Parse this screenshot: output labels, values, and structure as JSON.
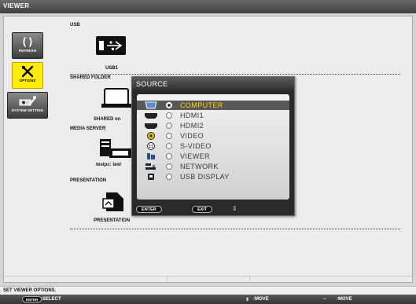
{
  "app": {
    "title": "VIEWER"
  },
  "sidebar": {
    "refresh_label": "REFRESH",
    "options_label": "OPTIONS",
    "system_setting_label": "SYSTEM SETTING"
  },
  "sections": {
    "usb": {
      "title": "USB",
      "item_label": "USB1"
    },
    "shared_folder": {
      "title": "SHARED FOLDER",
      "item_label": "SHARED on"
    },
    "media_server": {
      "title": "MEDIA SERVER",
      "item_label": "testpc: test"
    },
    "presentation": {
      "title": "PRESENTATION",
      "item_label": "PRESENTATION"
    }
  },
  "source_dialog": {
    "title": "SOURCE",
    "selected": "COMPUTER",
    "sources": [
      {
        "name": "COMPUTER",
        "icon": "computer-port-icon"
      },
      {
        "name": "HDMI1",
        "icon": "hdmi-icon"
      },
      {
        "name": "HDMI2",
        "icon": "hdmi-icon"
      },
      {
        "name": "VIDEO",
        "icon": "video-rca-icon"
      },
      {
        "name": "S-VIDEO",
        "icon": "s-video-icon"
      },
      {
        "name": "VIEWER",
        "icon": "viewer-icon"
      },
      {
        "name": "NETWORK",
        "icon": "network-icon"
      },
      {
        "name": "USB DISPLAY",
        "icon": "usb-display-icon"
      }
    ],
    "enter_label": "ENTER",
    "exit_label": "EXIT"
  },
  "status": {
    "text": "SET VIEWER OPTIONS."
  },
  "navbar": {
    "enter_key": "ENTER",
    "select_label": ":SELECT",
    "move_label_1": ":MOVE",
    "move_label_2": ":MOVE"
  },
  "colors": {
    "selected_text": "#ffd800",
    "options_highlight": "#ffee00"
  }
}
